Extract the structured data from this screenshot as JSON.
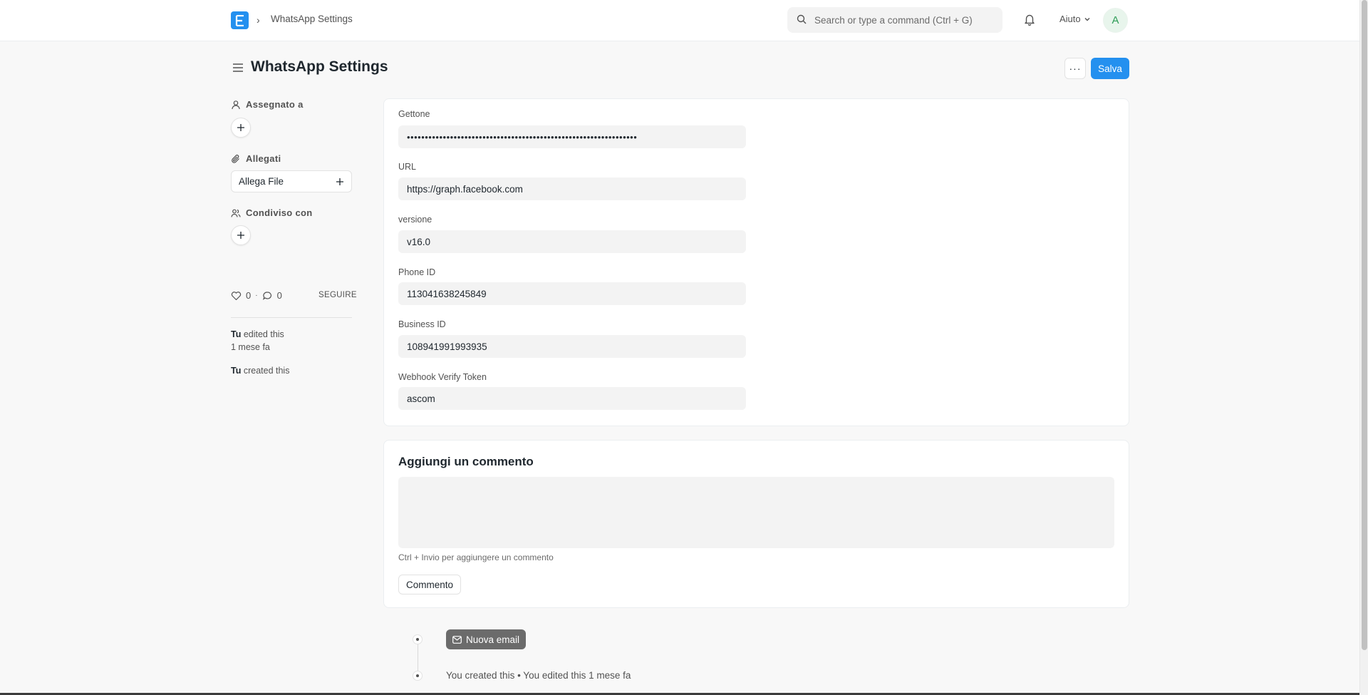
{
  "navbar": {
    "logo_letter": "E",
    "breadcrumb": "WhatsApp Settings",
    "search_placeholder": "Search or type a command (Ctrl + G)",
    "help_label": "Aiuto",
    "avatar_initial": "A"
  },
  "page": {
    "title": "WhatsApp Settings",
    "more_label": "···",
    "save_label": "Salva"
  },
  "sidebar": {
    "assigned_label": "Assegnato a",
    "attachments_label": "Allegati",
    "attach_file_label": "Allega File",
    "shared_label": "Condiviso con",
    "likes_count": "0",
    "comments_count": "0",
    "follow_label": "SEGUIRE",
    "activity": [
      {
        "user": "Tu",
        "action": "edited this",
        "time": "1 mese fa"
      },
      {
        "user": "Tu",
        "action": "created this",
        "time": ""
      }
    ]
  },
  "form": {
    "fields": [
      {
        "label": "Gettone",
        "value": "••••••••••••••••••••••••••••••••••••••••••••••••••••••••••••••••"
      },
      {
        "label": "URL",
        "value": "https://graph.facebook.com"
      },
      {
        "label": "versione",
        "value": "v16.0"
      },
      {
        "label": "Phone ID",
        "value": "113041638245849"
      },
      {
        "label": "Business ID",
        "value": "108941991993935"
      },
      {
        "label": "Webhook Verify Token",
        "value": "ascom"
      }
    ]
  },
  "comment": {
    "title": "Aggiungi un commento",
    "hint": "Ctrl + Invio per aggiungere un commento",
    "button_label": "Commento"
  },
  "timeline": {
    "new_email_label": "Nuova email",
    "entry_text": "You created this • You edited this 1 mese fa"
  }
}
